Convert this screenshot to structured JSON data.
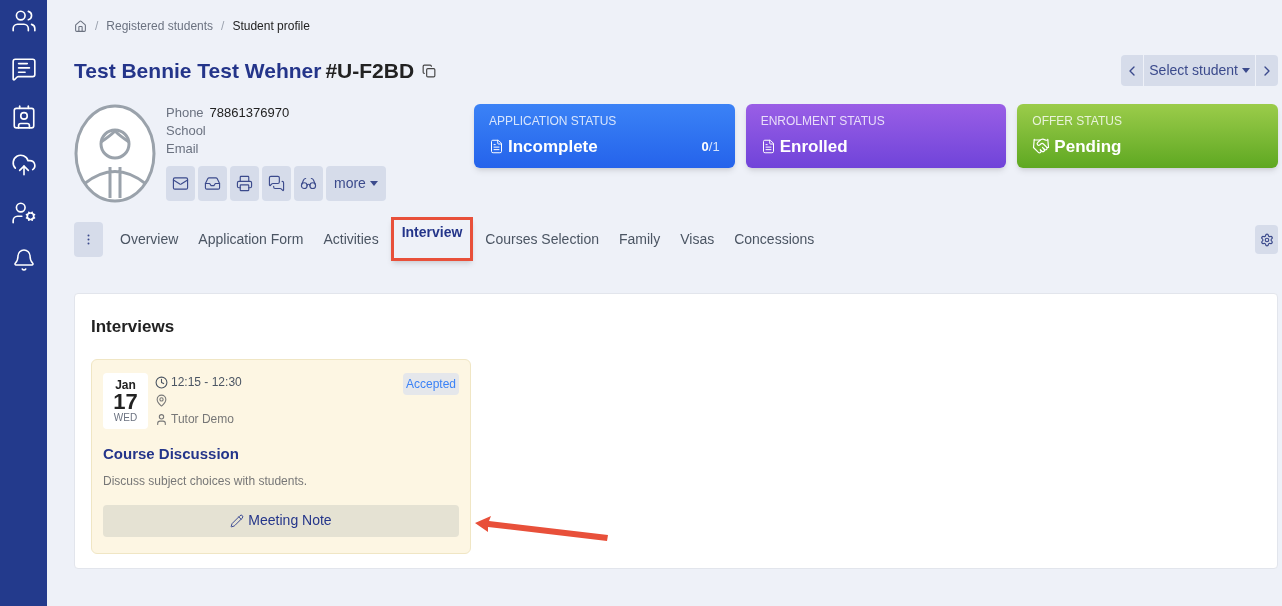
{
  "breadcrumb": [
    {
      "separator": "/",
      "label": "Registered students"
    },
    {
      "separator": "/",
      "label": "Student profile"
    }
  ],
  "title": {
    "name": "Test Bennie Test Wehner",
    "id": "#U-F2BD"
  },
  "student_selector": {
    "label": "Select student"
  },
  "contact": [
    {
      "label": "Phone",
      "value": "78861376970"
    },
    {
      "label": "School"
    },
    {
      "label": "Email"
    }
  ],
  "more_button": "more",
  "status_cards": [
    {
      "kind": "application",
      "heading": "APPLICATION STATUS",
      "value": "Incomplete",
      "count_done": "0",
      "count_total": "/1"
    },
    {
      "kind": "enrolment",
      "heading": "ENROLMENT STATUS",
      "value": "Enrolled"
    },
    {
      "kind": "offer",
      "heading": "OFFER STATUS",
      "value": "Pending"
    }
  ],
  "tabs": [
    {
      "label": "Overview",
      "selected": false,
      "highlighted": false
    },
    {
      "label": "Application Form",
      "selected": false,
      "highlighted": false
    },
    {
      "label": "Activities",
      "selected": false,
      "highlighted": false
    },
    {
      "label": "Interview",
      "selected": true,
      "highlighted": true
    },
    {
      "label": "Courses Selection",
      "selected": false,
      "highlighted": false
    },
    {
      "label": "Family",
      "selected": false,
      "highlighted": false
    },
    {
      "label": "Visas",
      "selected": false,
      "highlighted": false
    },
    {
      "label": "Concessions",
      "selected": false,
      "highlighted": false
    }
  ],
  "interviews": {
    "heading": "Interviews",
    "items": [
      {
        "month": "Jan",
        "day": "17",
        "weekday": "WED",
        "time": "12:15 - 12:30",
        "tutor": "Tutor Demo",
        "status": "Accepted",
        "title": "Course Discussion",
        "description": "Discuss subject choices with students.",
        "button": "Meeting Note",
        "arrow_annotation": true
      }
    ]
  }
}
